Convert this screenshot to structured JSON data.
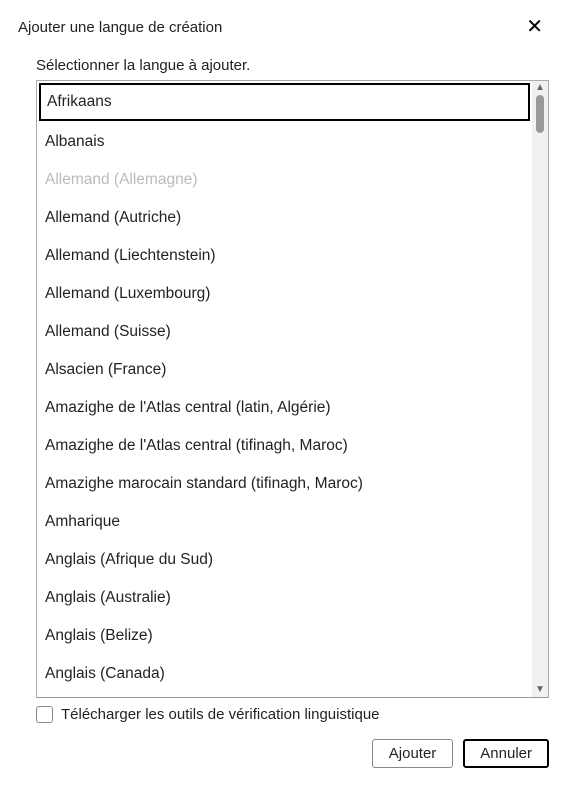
{
  "dialog": {
    "title": "Ajouter une langue de création",
    "instruction": "Sélectionner la langue à ajouter."
  },
  "languages": [
    {
      "label": "Afrikaans",
      "selected": true,
      "disabled": false
    },
    {
      "label": "Albanais",
      "selected": false,
      "disabled": false
    },
    {
      "label": "Allemand (Allemagne)",
      "selected": false,
      "disabled": true
    },
    {
      "label": "Allemand (Autriche)",
      "selected": false,
      "disabled": false
    },
    {
      "label": "Allemand (Liechtenstein)",
      "selected": false,
      "disabled": false
    },
    {
      "label": "Allemand (Luxembourg)",
      "selected": false,
      "disabled": false
    },
    {
      "label": "Allemand (Suisse)",
      "selected": false,
      "disabled": false
    },
    {
      "label": "Alsacien (France)",
      "selected": false,
      "disabled": false
    },
    {
      "label": "Amazighe de l'Atlas central (latin, Algérie)",
      "selected": false,
      "disabled": false
    },
    {
      "label": "Amazighe de l'Atlas central (tifinagh, Maroc)",
      "selected": false,
      "disabled": false
    },
    {
      "label": "Amazighe marocain standard (tifinagh, Maroc)",
      "selected": false,
      "disabled": false
    },
    {
      "label": "Amharique",
      "selected": false,
      "disabled": false
    },
    {
      "label": "Anglais (Afrique du Sud)",
      "selected": false,
      "disabled": false
    },
    {
      "label": "Anglais (Australie)",
      "selected": false,
      "disabled": false
    },
    {
      "label": "Anglais (Belize)",
      "selected": false,
      "disabled": false
    },
    {
      "label": "Anglais (Canada)",
      "selected": false,
      "disabled": false
    }
  ],
  "footer": {
    "checkbox_label": "Télécharger les outils de vérification linguistique",
    "add_button": "Ajouter",
    "cancel_button": "Annuler"
  }
}
